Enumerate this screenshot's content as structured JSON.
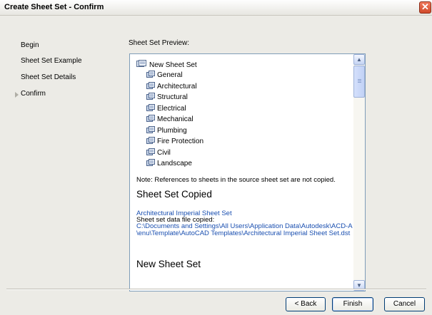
{
  "window": {
    "title": "Create Sheet Set - Confirm",
    "close_glyph": "✕"
  },
  "nav": {
    "items": [
      {
        "label": "Begin"
      },
      {
        "label": "Sheet Set Example"
      },
      {
        "label": "Sheet Set Details"
      },
      {
        "label": "Confirm",
        "current": true
      }
    ]
  },
  "preview": {
    "label": "Sheet Set Preview:",
    "tree": {
      "root": {
        "label": "New Sheet Set",
        "icon": "sheet-set-icon"
      },
      "subsets": [
        {
          "label": "General"
        },
        {
          "label": "Architectural"
        },
        {
          "label": "Structural"
        },
        {
          "label": "Electrical"
        },
        {
          "label": "Mechanical"
        },
        {
          "label": "Plumbing"
        },
        {
          "label": "Fire Protection"
        },
        {
          "label": "Civil"
        },
        {
          "label": "Landscape"
        }
      ],
      "subset_icon": "subset-folder-icon"
    },
    "note": "Note: References to sheets in the source sheet set are not copied.",
    "copied_heading": "Sheet Set Copied",
    "source_name": "Architectural Imperial Sheet Set",
    "data_file_label": "Sheet set data file copied:",
    "path_line1": "C:\\Documents and Settings\\All Users\\Application Data\\Autodesk\\ACD-A",
    "path_line2": "\\enu\\Template\\AutoCAD Templates\\Architectural Imperial Sheet Set.dst",
    "new_heading": "New Sheet Set"
  },
  "scrollbar": {
    "up": "▲",
    "down": "▼"
  },
  "buttons": {
    "back": "< Back",
    "finish": "Finish",
    "cancel": "Cancel"
  },
  "colors": {
    "accent_link": "#1a4fb0",
    "dialog_bg": "#ecebe6",
    "close_red": "#d14a2a"
  }
}
